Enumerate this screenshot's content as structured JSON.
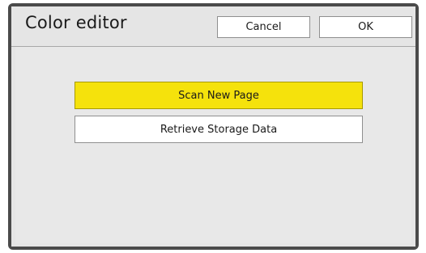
{
  "window": {
    "title": "Color editor"
  },
  "header": {
    "cancel_label": "Cancel",
    "ok_label": "OK"
  },
  "main": {
    "scan_label": "Scan New Page",
    "retrieve_label": "Retrieve Storage Data"
  },
  "colors": {
    "accent": "#f5e20c",
    "bezel": "#4a4a4a",
    "panel": "#e5e5e5"
  }
}
